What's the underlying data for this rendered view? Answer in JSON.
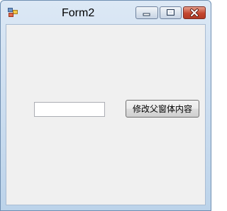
{
  "window": {
    "title": "Form2",
    "controls": {
      "minimize": "minimize-icon",
      "maximize": "maximize-icon",
      "close": "close-icon"
    }
  },
  "form": {
    "textbox_value": "",
    "button_label": "修改父窗体内容"
  },
  "colors": {
    "client_background": "#f0f0f0",
    "titlebar": "#c9dbee",
    "close_button": "#c4462f"
  }
}
